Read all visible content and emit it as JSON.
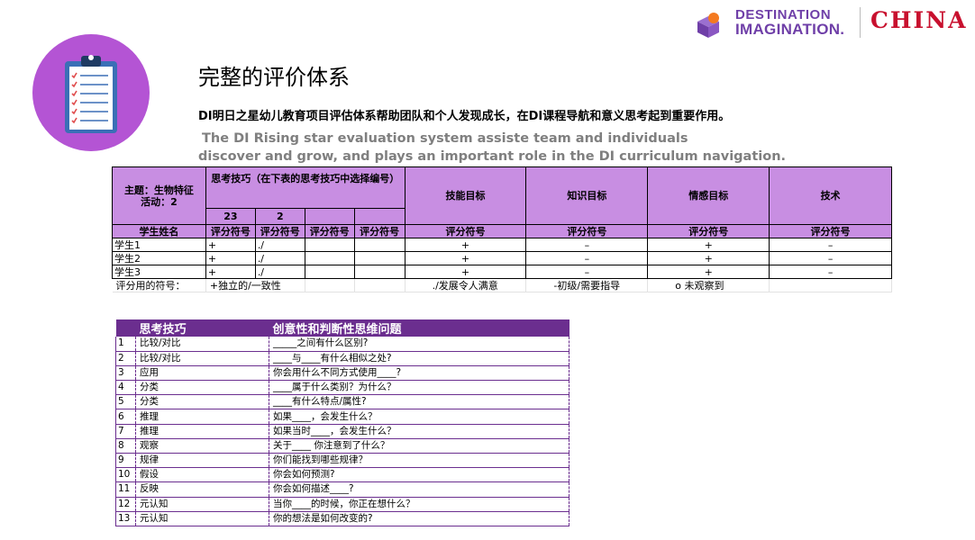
{
  "logo": {
    "line1": "DESTINATION",
    "line2": "IMAGINATION.",
    "country": "CHINA",
    "colors": {
      "purple": "#6f3fa8",
      "orange": "#f47a20",
      "red": "#c8102e"
    }
  },
  "icon": {
    "name": "clipboard-icon",
    "circle_color": "#b454d4"
  },
  "title": "完整的评价体系",
  "subtitle_cn": "DI明日之星幼儿教育项目评估体系帮助团队和个人发现成长，在DI课程导航和意义思考起到重要作用。",
  "subtitle_en_1": "The DI Rising star evaluation system assiste team and individuals",
  "subtitle_en_2": "discover and grow, and plays an important role in the DI curriculum navigation.",
  "eval_table": {
    "topic": "主题：生物特征",
    "activity": "活动：2",
    "thinking_header": "思考技巧（在下表的思考技巧中选择编号）",
    "thinking_nums": [
      "23",
      "2",
      "",
      ""
    ],
    "goals": [
      "技能目标",
      "知识目标",
      "情感目标",
      "技术"
    ],
    "student_col": "学生姓名",
    "symbol_label": "评分符号",
    "students": [
      {
        "name": "学生1",
        "t": [
          "+",
          "./",
          "",
          ""
        ],
        "g": [
          "+",
          "–",
          "+",
          "–"
        ]
      },
      {
        "name": "学生2",
        "t": [
          "+",
          "./",
          "",
          ""
        ],
        "g": [
          "+",
          "–",
          "+",
          "–"
        ]
      },
      {
        "name": "学生3",
        "t": [
          "+",
          "./",
          "",
          ""
        ],
        "g": [
          "+",
          "–",
          "+",
          "–"
        ]
      }
    ],
    "legend_label": "评分用的符号：",
    "legend": [
      "+独立的/一致性",
      "./发展令人满意",
      "-初级/需要指导",
      "o  未观察到"
    ]
  },
  "skills_table": {
    "headers": [
      "思考技巧",
      "创意性和判断性思维问题"
    ],
    "rows": [
      {
        "num": "1",
        "skill": "比较/对比",
        "q": "_____之间有什么区别?"
      },
      {
        "num": "2",
        "skill": "比较/对比",
        "q": "____与____有什么相似之处?"
      },
      {
        "num": "3",
        "skill": "应用",
        "q": "你会用什么不同方式使用____?"
      },
      {
        "num": "4",
        "skill": "分类",
        "q": "____属于什么类别？为什么？"
      },
      {
        "num": "5",
        "skill": "分类",
        "q": "____有什么特点/属性?"
      },
      {
        "num": "6",
        "skill": "推理",
        "q": "如果____，会发生什么？"
      },
      {
        "num": "7",
        "skill": "推理",
        "q": "如果当时____，会发生什么？"
      },
      {
        "num": "8",
        "skill": "观察",
        "q": "关于____ 你注意到了什么？"
      },
      {
        "num": "9",
        "skill": "规律",
        "q": "你们能找到哪些规律？"
      },
      {
        "num": "10",
        "skill": "假设",
        "q": "你会如何预测?"
      },
      {
        "num": "11",
        "skill": "反映",
        "q": "你会如何描述____?"
      },
      {
        "num": "12",
        "skill": "元认知",
        "q": "当你____的时候，你正在想什么？"
      },
      {
        "num": "13",
        "skill": "元认知",
        "q": "你的想法是如何改变的?"
      }
    ]
  }
}
